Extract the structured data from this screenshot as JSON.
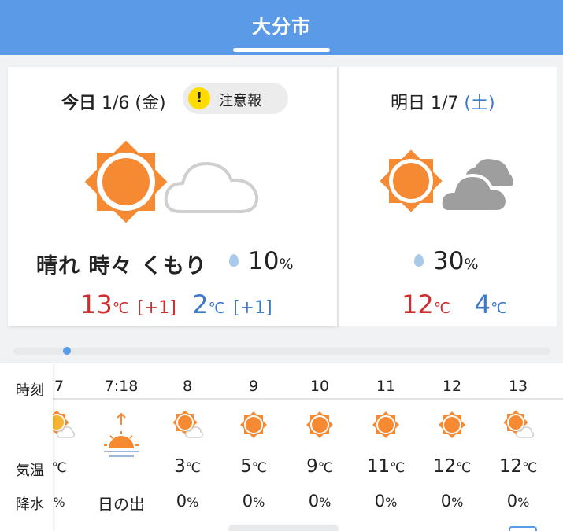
{
  "header": {
    "title": "大分市"
  },
  "today": {
    "label": "今日",
    "date": "1/6",
    "weekday": "(金)",
    "alert": {
      "icon": "!",
      "label": "注意報",
      "icon_color": "#ffdc00"
    },
    "weather_icon": "sun-with-cloud-icon",
    "weather": "晴れ 時々 くもり",
    "precip": "10",
    "precip_unit": "%",
    "high": "13",
    "high_unit": "℃",
    "high_diff": "[+1]",
    "low": "2",
    "low_unit": "℃",
    "low_diff": "[+1]"
  },
  "tomorrow": {
    "label": "明日",
    "date": "1/7",
    "weekday": "(土)",
    "weather_icon": "sun-with-dark-cloud-icon",
    "precip": "30",
    "precip_unit": "%",
    "high": "12",
    "high_unit": "℃",
    "low": "4",
    "low_unit": "℃"
  },
  "timeline": {
    "position": 0.1
  },
  "hourly": {
    "labels": {
      "time": "時刻",
      "temp": "気温",
      "precip": "降水"
    },
    "cols": [
      {
        "time": "7",
        "icon": "sun-cloud-icon",
        "temp": "",
        "temp_unit": "℃",
        "precip": "",
        "precip_unit": "%"
      },
      {
        "time": "7:18",
        "icon": "sunrise-icon",
        "label": "日の出"
      },
      {
        "time": "8",
        "icon": "sun-cloud-icon",
        "temp": "3",
        "temp_unit": "℃",
        "precip": "0",
        "precip_unit": "%"
      },
      {
        "time": "9",
        "icon": "sun-icon",
        "temp": "5",
        "temp_unit": "℃",
        "precip": "0",
        "precip_unit": "%"
      },
      {
        "time": "10",
        "icon": "sun-icon",
        "temp": "9",
        "temp_unit": "℃",
        "precip": "0",
        "precip_unit": "%"
      },
      {
        "time": "11",
        "icon": "sun-icon",
        "temp": "11",
        "temp_unit": "℃",
        "precip": "0",
        "precip_unit": "%"
      },
      {
        "time": "12",
        "icon": "sun-icon",
        "temp": "12",
        "temp_unit": "℃",
        "precip": "0",
        "precip_unit": "%"
      },
      {
        "time": "13",
        "icon": "sun-cloud-icon",
        "temp": "12",
        "temp_unit": "℃",
        "precip": "0",
        "precip_unit": "%"
      }
    ]
  },
  "colors": {
    "header": "#5b9ae6",
    "high": "#cf2e2e",
    "low": "#3b79c9",
    "sun": "#f58a33"
  }
}
